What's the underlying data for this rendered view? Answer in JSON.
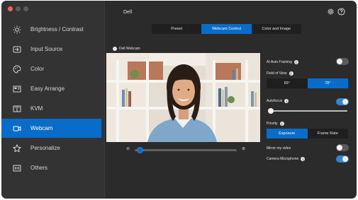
{
  "window": {
    "title": "Dell"
  },
  "sidebar": {
    "items": [
      {
        "label": "Brightness / Contrast",
        "icon": "sun-icon",
        "active": false
      },
      {
        "label": "Input Source",
        "icon": "input-source-icon",
        "active": false
      },
      {
        "label": "Color",
        "icon": "palette-icon",
        "active": false
      },
      {
        "label": "Easy Arrange",
        "icon": "layout-icon",
        "active": false
      },
      {
        "label": "KVM",
        "icon": "kvm-icon",
        "active": false
      },
      {
        "label": "Webcam",
        "icon": "webcam-icon",
        "active": true
      },
      {
        "label": "Personalize",
        "icon": "star-icon",
        "active": false
      },
      {
        "label": "Others",
        "icon": "others-icon",
        "active": false
      }
    ]
  },
  "tabs": [
    {
      "label": "Preset",
      "active": false
    },
    {
      "label": "Webcam Control",
      "active": true
    },
    {
      "label": "Color and Image",
      "active": false
    }
  ],
  "camera": {
    "label": "Dell Webcam"
  },
  "zoom": {
    "level": 0.04
  },
  "controls": {
    "ai_auto_framing": {
      "label": "AI Auto Framing",
      "on": false
    },
    "field_of_view": {
      "label": "Field of View",
      "options": [
        "65°",
        "78°"
      ],
      "selected": "78°"
    },
    "autofocus": {
      "label": "Autofocus",
      "on": true,
      "level": 0.0
    },
    "priority": {
      "label": "Priority",
      "options": [
        "Exposure",
        "Frame Rate"
      ],
      "selected": "Exposure"
    },
    "mirror": {
      "label": "Mirror my video",
      "on": false
    },
    "camera_microphone": {
      "label": "Camera Microphone",
      "on": true
    }
  },
  "colors": {
    "accent": "#0a6cc9",
    "background": "#2b2b2b",
    "sidebar": "#333333"
  }
}
